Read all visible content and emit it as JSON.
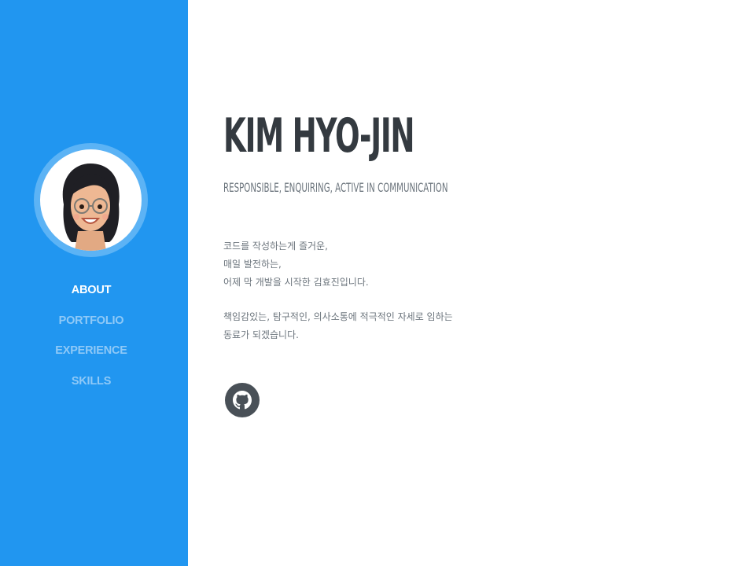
{
  "sidebar": {
    "nav": [
      {
        "label": "ABOUT",
        "active": true
      },
      {
        "label": "PORTFOLIO",
        "active": false
      },
      {
        "label": "EXPERIENCE",
        "active": false
      },
      {
        "label": "SKILLS",
        "active": false
      }
    ]
  },
  "profile": {
    "name": "KIM HYO-JIN",
    "subtitle": "RESPONSIBLE, ENQUIRING, ACTIVE IN COMMUNICATION",
    "bio": [
      [
        "코드를 작성하는게 즐거운,",
        "매일 발전하는,",
        "어제 막 개발을 시작한 김효진입니다."
      ],
      [
        "책임감있는, 탐구적인, 의사소통에 적극적인 자세로 임하는",
        "동료가 되겠습니다."
      ]
    ]
  },
  "links": {
    "github_icon": "github-icon"
  },
  "colors": {
    "sidebar": "#2196f0",
    "nav_active": "#ffffff",
    "nav_inactive": "#8fc9f7",
    "heading": "#343a40",
    "muted": "#6c757d",
    "icon_bg": "#495057"
  }
}
